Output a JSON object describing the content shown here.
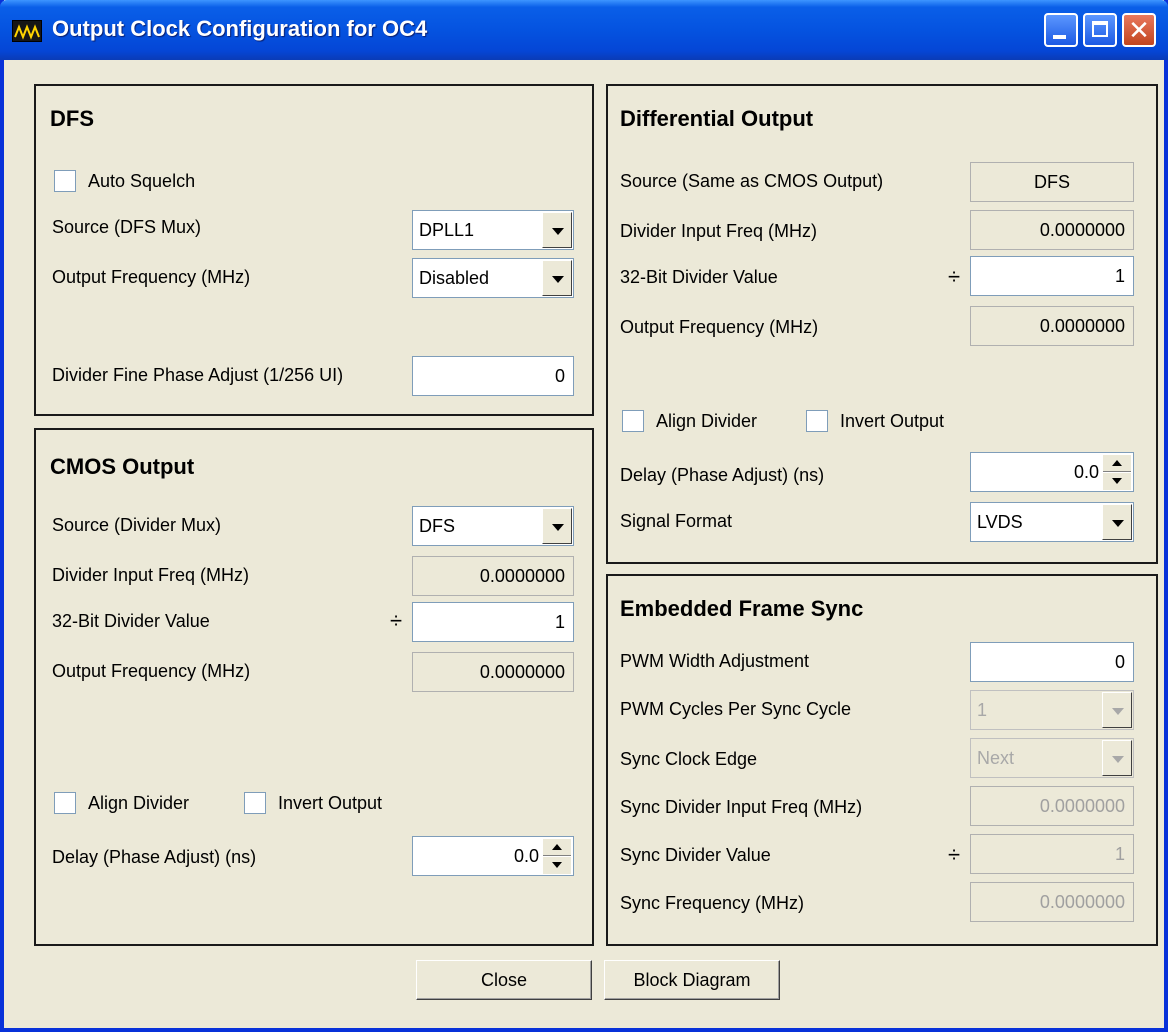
{
  "window": {
    "title": "Output Clock Configuration for OC4",
    "close_glyph": "✕"
  },
  "dfs": {
    "title": "DFS",
    "auto_squelch_label": "Auto Squelch",
    "source_label": "Source (DFS Mux)",
    "source_value": "DPLL1",
    "output_freq_label": "Output Frequency (MHz)",
    "output_freq_value": "Disabled",
    "fine_phase_label": "Divider Fine Phase Adjust (1/256 UI)",
    "fine_phase_value": "0"
  },
  "cmos": {
    "title": "CMOS Output",
    "source_label": "Source (Divider Mux)",
    "source_value": "DFS",
    "input_freq_label": "Divider Input Freq (MHz)",
    "input_freq_value": "0.0000000",
    "divider_label": "32-Bit Divider Value",
    "divide_symbol": "÷",
    "divider_value": "1",
    "output_freq_label": "Output Frequency (MHz)",
    "output_freq_value": "0.0000000",
    "align_divider_label": "Align Divider",
    "invert_output_label": "Invert Output",
    "delay_label": "Delay (Phase Adjust) (ns)",
    "delay_value": "0.0"
  },
  "diff": {
    "title": "Differential Output",
    "source_label": "Source (Same as CMOS Output)",
    "source_value": "DFS",
    "input_freq_label": "Divider Input Freq (MHz)",
    "input_freq_value": "0.0000000",
    "divider_label": "32-Bit Divider Value",
    "divide_symbol": "÷",
    "divider_value": "1",
    "output_freq_label": "Output Frequency (MHz)",
    "output_freq_value": "0.0000000",
    "align_divider_label": "Align Divider",
    "invert_output_label": "Invert Output",
    "delay_label": "Delay (Phase Adjust) (ns)",
    "delay_value": "0.0",
    "signal_format_label": "Signal Format",
    "signal_format_value": "LVDS"
  },
  "efs": {
    "title": "Embedded Frame Sync",
    "pwm_width_label": "PWM Width Adjustment",
    "pwm_width_value": "0",
    "pwm_cycles_label": "PWM Cycles Per Sync Cycle",
    "pwm_cycles_value": "1",
    "sync_edge_label": "Sync Clock Edge",
    "sync_edge_value": "Next",
    "sync_input_freq_label": "Sync Divider Input Freq (MHz)",
    "sync_input_freq_value": "0.0000000",
    "sync_divider_label": "Sync Divider Value",
    "divide_symbol": "÷",
    "sync_divider_value": "1",
    "sync_freq_label": "Sync Frequency (MHz)",
    "sync_freq_value": "0.0000000"
  },
  "buttons": {
    "close": "Close",
    "block_diagram": "Block Diagram"
  }
}
